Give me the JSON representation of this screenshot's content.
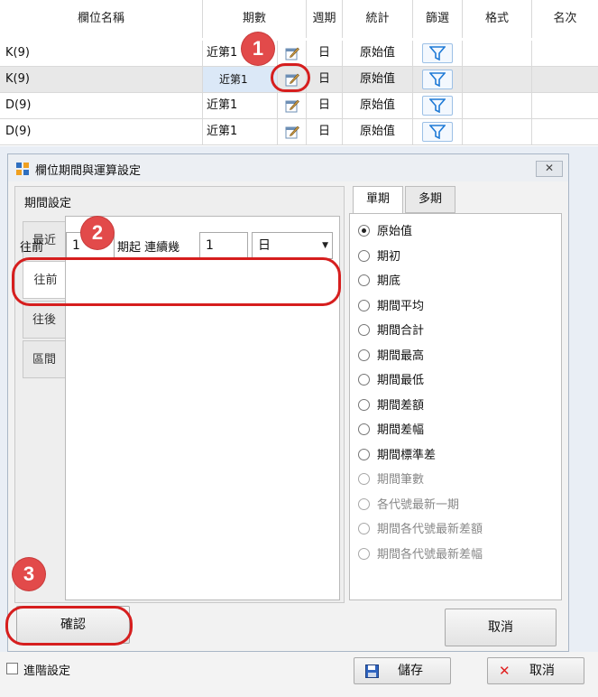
{
  "grid": {
    "headers": [
      "欄位名稱",
      "期數",
      "週期",
      "統計",
      "篩選",
      "格式",
      "名次"
    ],
    "rows": [
      {
        "name": "K(9)",
        "period": "近第1",
        "cycle": "日",
        "stat": "原始值"
      },
      {
        "name": "K(9)",
        "period": "近第1",
        "cycle": "日",
        "stat": "原始值"
      },
      {
        "name": "D(9)",
        "period": "近第1",
        "cycle": "日",
        "stat": "原始值"
      },
      {
        "name": "D(9)",
        "period": "近第1",
        "cycle": "日",
        "stat": "原始值"
      }
    ]
  },
  "dialog": {
    "title": "欄位期間與運算設定",
    "close_label": "✕",
    "period_section_title": "期間設定",
    "period_tabs": [
      "最近",
      "往前",
      "往後",
      "區間"
    ],
    "setting": {
      "prefix": "往前",
      "count_value": "1",
      "mid_label": "期起 連續幾",
      "span_value": "1",
      "cycle_value": "日"
    },
    "stat_tabs": [
      "單期",
      "多期"
    ],
    "stat_options": [
      {
        "label": "原始值",
        "checked": true,
        "enabled": true
      },
      {
        "label": "期初",
        "checked": false,
        "enabled": true
      },
      {
        "label": "期底",
        "checked": false,
        "enabled": true
      },
      {
        "label": "期間平均",
        "checked": false,
        "enabled": true
      },
      {
        "label": "期間合計",
        "checked": false,
        "enabled": true
      },
      {
        "label": "期間最高",
        "checked": false,
        "enabled": true
      },
      {
        "label": "期間最低",
        "checked": false,
        "enabled": true
      },
      {
        "label": "期間差額",
        "checked": false,
        "enabled": true
      },
      {
        "label": "期間差幅",
        "checked": false,
        "enabled": true
      },
      {
        "label": "期間標準差",
        "checked": false,
        "enabled": true
      },
      {
        "label": "期間筆數",
        "checked": false,
        "enabled": false
      },
      {
        "label": "各代號最新一期",
        "checked": false,
        "enabled": false
      },
      {
        "label": "期間各代號最新差額",
        "checked": false,
        "enabled": false
      },
      {
        "label": "期間各代號最新差幅",
        "checked": false,
        "enabled": false
      }
    ],
    "confirm_label": "確認",
    "cancel_label": "取消"
  },
  "bottom": {
    "advanced_label": "進階設定",
    "save_label": "儲存",
    "cancel_label": "取消"
  },
  "annotations": [
    "1",
    "2",
    "3"
  ],
  "colors": {
    "annotation": "#e24a4a",
    "filter_icon": "#1f7ad6",
    "cancel_x": "#e02020"
  }
}
